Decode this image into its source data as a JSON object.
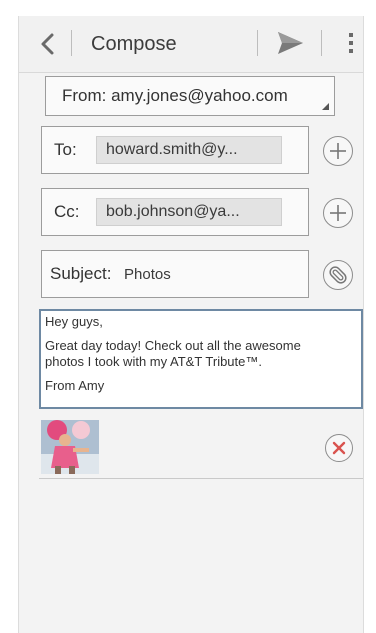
{
  "header": {
    "title": "Compose",
    "back_icon": "chevron-left-icon",
    "send_icon": "send-icon",
    "menu_icon": "overflow-menu-icon"
  },
  "from": {
    "label": "From: amy.jones@yahoo.com"
  },
  "to": {
    "label": "To:",
    "recipient": "howard.smith@y...",
    "add_icon": "plus-icon"
  },
  "cc": {
    "label": "Cc:",
    "recipient": "bob.johnson@ya...",
    "add_icon": "plus-icon"
  },
  "subject": {
    "label": "Subject:",
    "value": "Photos",
    "attach_icon": "paperclip-icon"
  },
  "body": {
    "greeting": "Hey guys,",
    "line1": "  Great day today! Check out all the awesome",
    "line2": "photos I took with my AT&T Tribute™.",
    "signoff": "From Amy"
  },
  "attachment": {
    "remove_icon": "close-icon",
    "accent_color": "#d9534f"
  }
}
